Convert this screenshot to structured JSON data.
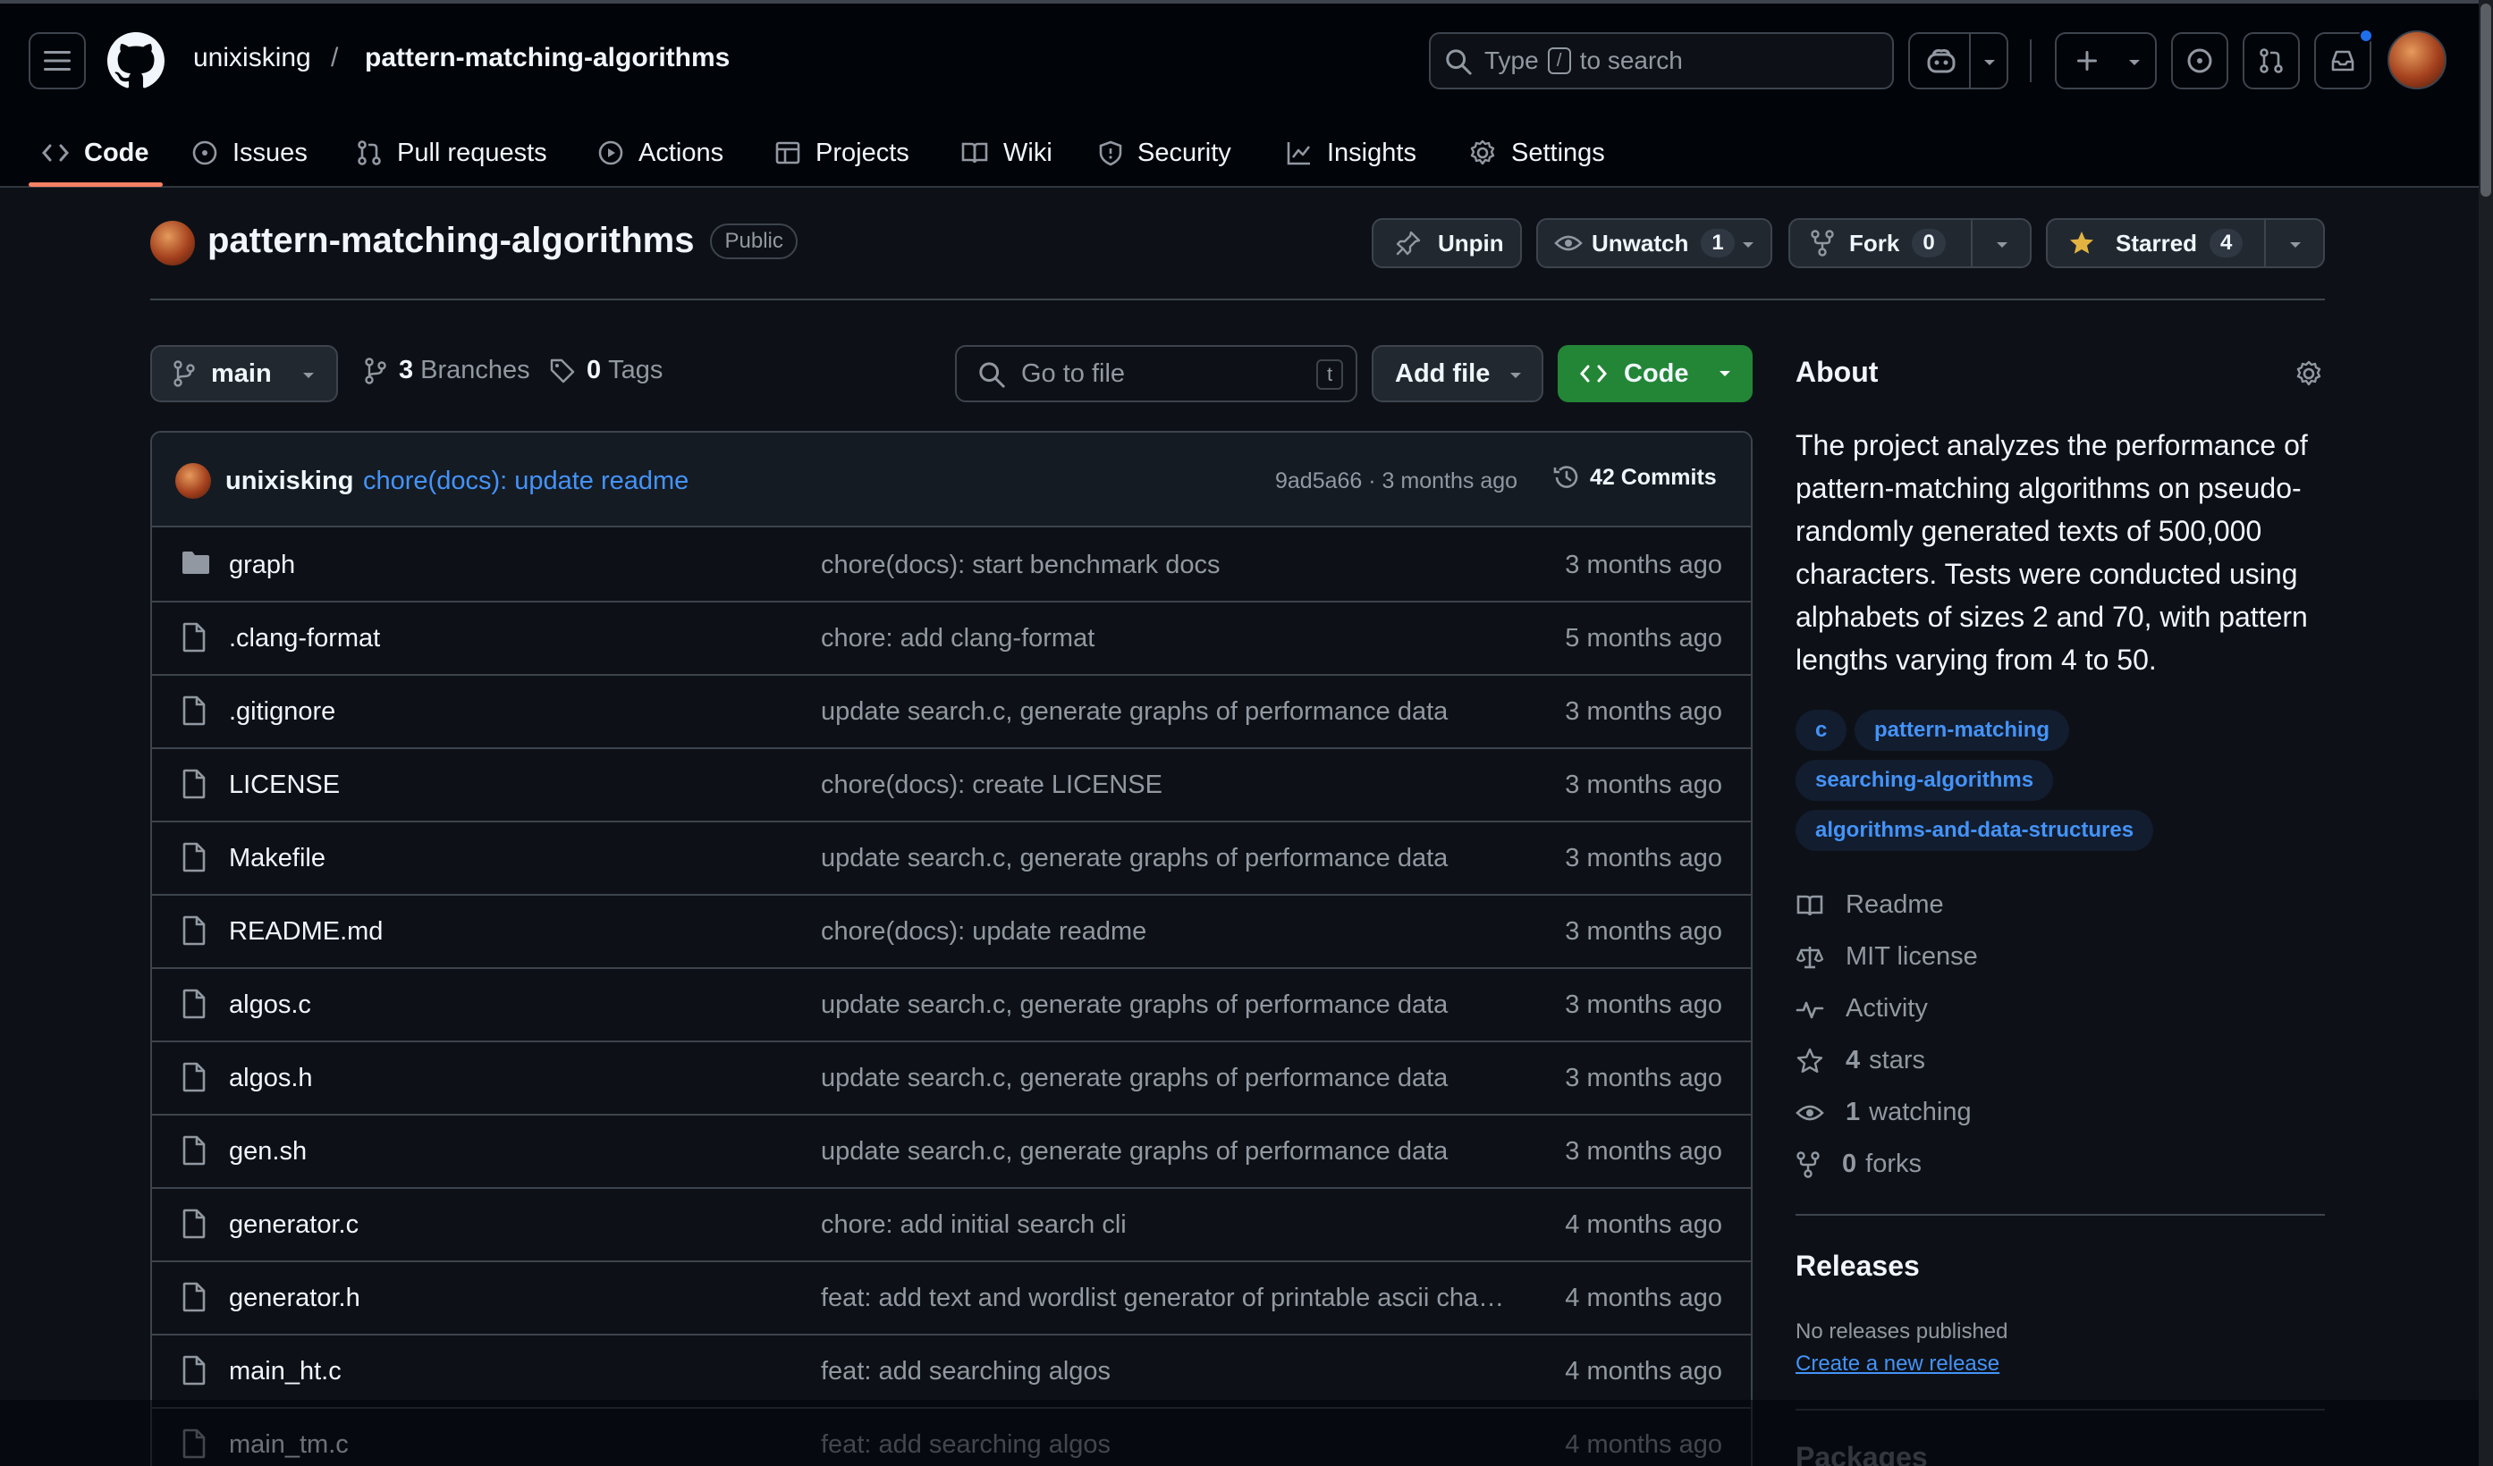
{
  "header": {
    "owner": "unixisking",
    "separator": "/",
    "repo": "pattern-matching-algorithms",
    "search_pre": "Type",
    "search_key": "/",
    "search_post": "to search"
  },
  "tabs": [
    {
      "label": "Code",
      "icon": "code-icon"
    },
    {
      "label": "Issues",
      "icon": "issue-icon"
    },
    {
      "label": "Pull requests",
      "icon": "pull-request-icon"
    },
    {
      "label": "Actions",
      "icon": "play-icon"
    },
    {
      "label": "Projects",
      "icon": "table-icon"
    },
    {
      "label": "Wiki",
      "icon": "book-icon"
    },
    {
      "label": "Security",
      "icon": "shield-icon"
    },
    {
      "label": "Insights",
      "icon": "graph-icon"
    },
    {
      "label": "Settings",
      "icon": "gear-icon"
    }
  ],
  "repo_header": {
    "name": "pattern-matching-algorithms",
    "visibility": "Public",
    "unpin": "Unpin",
    "unwatch": "Unwatch",
    "watch_count": "1",
    "fork": "Fork",
    "fork_count": "0",
    "starred": "Starred",
    "star_count": "4"
  },
  "toolbar": {
    "branch": "main",
    "branches_count": "3",
    "branches_label": "Branches",
    "tags_count": "0",
    "tags_label": "Tags",
    "go_to_file": "Go to file",
    "go_to_file_key": "t",
    "add_file": "Add file",
    "code": "Code"
  },
  "latest_commit": {
    "author": "unixisking",
    "message": "chore(docs): update readme",
    "hash_time": "9ad5a66 · 3 months ago",
    "commits": "42 Commits"
  },
  "files": [
    {
      "name": "graph",
      "type": "folder",
      "message": "chore(docs): start benchmark docs",
      "time": "3 months ago"
    },
    {
      "name": ".clang-format",
      "type": "file",
      "message": "chore: add clang-format",
      "time": "5 months ago"
    },
    {
      "name": ".gitignore",
      "type": "file",
      "message": "update search.c, generate graphs of performance data",
      "time": "3 months ago"
    },
    {
      "name": "LICENSE",
      "type": "file",
      "message": "chore(docs): create LICENSE",
      "time": "3 months ago"
    },
    {
      "name": "Makefile",
      "type": "file",
      "message": "update search.c, generate graphs of performance data",
      "time": "3 months ago"
    },
    {
      "name": "README.md",
      "type": "file",
      "message": "chore(docs): update readme",
      "time": "3 months ago"
    },
    {
      "name": "algos.c",
      "type": "file",
      "message": "update search.c, generate graphs of performance data",
      "time": "3 months ago"
    },
    {
      "name": "algos.h",
      "type": "file",
      "message": "update search.c, generate graphs of performance data",
      "time": "3 months ago"
    },
    {
      "name": "gen.sh",
      "type": "file",
      "message": "update search.c, generate graphs of performance data",
      "time": "3 months ago"
    },
    {
      "name": "generator.c",
      "type": "file",
      "message": "chore: add initial search cli",
      "time": "4 months ago"
    },
    {
      "name": "generator.h",
      "type": "file",
      "message": "feat: add text and wordlist generator of printable ascii cha…",
      "time": "4 months ago"
    },
    {
      "name": "main_ht.c",
      "type": "file",
      "message": "feat: add searching algos",
      "time": "4 months ago"
    },
    {
      "name": "main_tm.c",
      "type": "file",
      "message": "feat: add searching algos",
      "time": "4 months ago"
    }
  ],
  "about": {
    "title": "About",
    "description": "The project analyzes the performance of pattern-matching algorithms on pseudo-randomly generated texts of 500,000 characters. Tests were conducted using alphabets of sizes 2 and 70, with pattern lengths varying from 4 to 50.",
    "topics": [
      "c",
      "pattern-matching",
      "searching-algorithms",
      "algorithms-and-data-structures"
    ],
    "readme": "Readme",
    "license": "MIT license",
    "activity": "Activity",
    "stars_count": "4",
    "stars_label": "stars",
    "watching_count": "1",
    "watching_label": "watching",
    "forks_count": "0",
    "forks_label": "forks"
  },
  "releases": {
    "title": "Releases",
    "none": "No releases published",
    "create": "Create a new release"
  },
  "packages": {
    "title": "Packages"
  },
  "colors": {
    "accent_green": "#238636",
    "link_blue": "#4493f8",
    "tab_underline": "#f78166",
    "star_yellow": "#e3b341"
  }
}
